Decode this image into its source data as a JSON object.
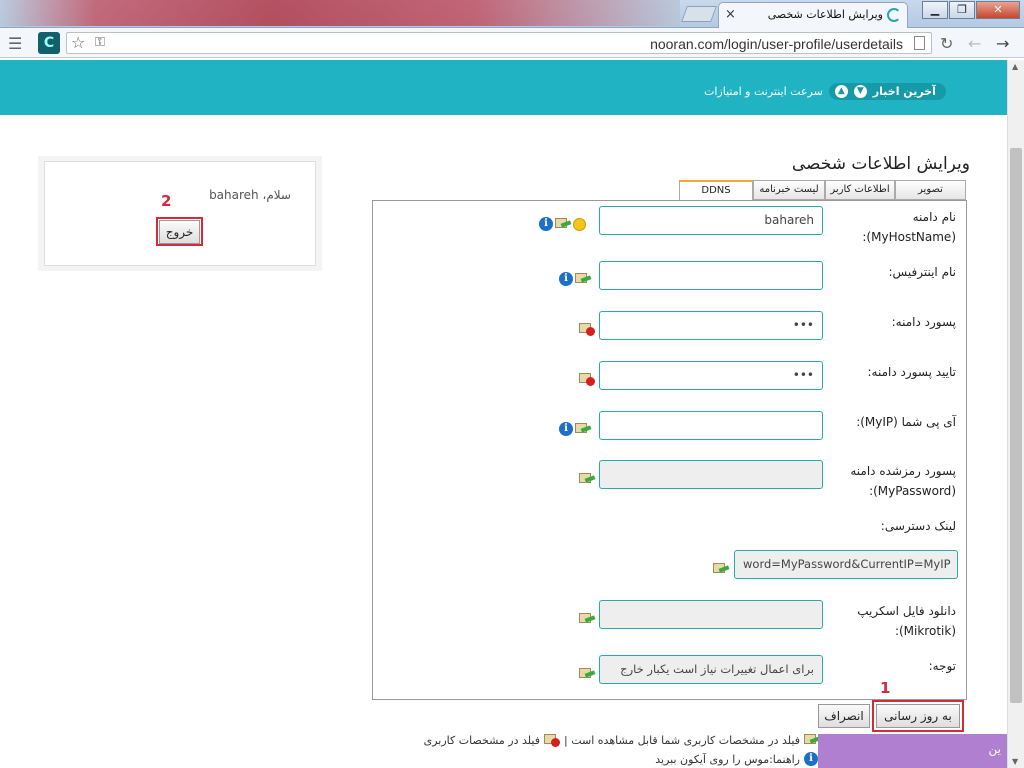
{
  "browser": {
    "tab_title": "ویرایش اطلاعات شخصی",
    "tab_close": "×",
    "url": "nooran.com/login/user-profile/userdetails",
    "window_buttons": [
      "▁",
      "❐",
      "✕"
    ]
  },
  "banner": {
    "news_label": "آخرین اخبار",
    "news_item": "سرعت اینترنت و امتیازات"
  },
  "page": {
    "title": "ویرایش اطلاعات شخصی",
    "tabs": [
      "تصویر",
      "اطلاعات کاربر",
      "لیست خبرنامه",
      "DDNS"
    ],
    "active_tab": "DDNS"
  },
  "form": {
    "hostname_label_1": "نام دامنه",
    "hostname_label_2": "(MyHostName):",
    "hostname_value": "bahareh",
    "interface_label": "نام اینترفیس:",
    "interface_value": "",
    "password_label": "پسورد دامنه:",
    "password_value": "•••",
    "confirm_label": "تایید پسورد دامنه:",
    "confirm_value": "•••",
    "myip_label": "آی پی شما (MyIP):",
    "myip_value": "",
    "encpass_label_1": "پسورد رمزشده دامنه",
    "encpass_label_2": "(MyPassword):",
    "encpass_value": "",
    "link_label": "لینک دسترسی:",
    "link_value": "word=MyPassword&CurrentIP=MyIP",
    "mikrotik_label_1": "دانلود فایل اسکریپ",
    "mikrotik_label_2": "(Mikrotik):",
    "mikrotik_value": "",
    "note_label": "توجه:",
    "note_value": "برای اعمال تغییرات نیاز است یکبار خارج"
  },
  "buttons": {
    "update": "به روز رسانی",
    "cancel": "انصراف",
    "logout": "خروج"
  },
  "annotations": {
    "marker_1": "1",
    "marker_2": "2"
  },
  "sidebar": {
    "greeting": "سلام، bahareh"
  },
  "legend": {
    "line1_a": "فیلد در مشخصات کاربری شما قابل مشاهده است |",
    "line1_b": "فیلد در مشخصات کاربری",
    "line2": "راهنما:موس را روی آیکون ببرید"
  },
  "popup": {
    "text": "ین"
  },
  "colors": {
    "banner": "#1fb3c3",
    "accent_border": "#27a9ae",
    "highlight_red": "#d42a3a",
    "tab_active_top": "#f4a731"
  }
}
